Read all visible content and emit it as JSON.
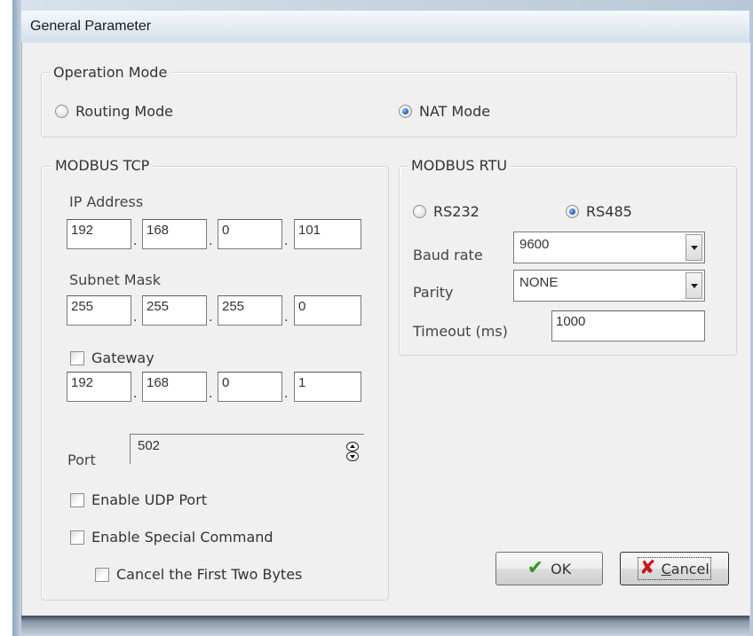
{
  "window": {
    "title": "General Parameter"
  },
  "operation_mode": {
    "title": "Operation Mode",
    "options": [
      {
        "label": "Routing Mode",
        "selected": false
      },
      {
        "label": "NAT Mode",
        "selected": true
      }
    ]
  },
  "modbus_tcp": {
    "title": "MODBUS TCP",
    "ip_address": {
      "label": "IP Address",
      "octets": [
        "192",
        "168",
        "0",
        "101"
      ]
    },
    "subnet_mask": {
      "label": "Subnet Mask",
      "octets": [
        "255",
        "255",
        "255",
        "0"
      ]
    },
    "gateway": {
      "label": "Gateway",
      "checked": false,
      "octets": [
        "192",
        "168",
        "0",
        "1"
      ]
    },
    "port": {
      "label": "Port",
      "value": "502"
    },
    "enable_udp": {
      "label": "Enable UDP Port",
      "checked": false
    },
    "enable_special": {
      "label": "Enable Special Command",
      "checked": false
    },
    "cancel_first_two": {
      "label": "Cancel the First Two Bytes",
      "checked": false
    }
  },
  "modbus_rtu": {
    "title": "MODBUS RTU",
    "interfaces": [
      {
        "label": "RS232",
        "selected": false
      },
      {
        "label": "RS485",
        "selected": true
      }
    ],
    "baud_rate": {
      "label": "Baud rate",
      "value": "9600"
    },
    "parity": {
      "label": "Parity",
      "value": "NONE"
    },
    "timeout": {
      "label": "Timeout (ms)",
      "value": "1000"
    }
  },
  "buttons": {
    "ok": "OK",
    "cancel_prefix": "",
    "cancel_underline": "C",
    "cancel_rest": "ancel"
  },
  "colors": {
    "ok_icon": "#2e9a1d",
    "cancel_icon": "#c8161d",
    "radio_selected": "#2a6fd0"
  },
  "icons": {
    "ok": "check-icon",
    "cancel": "x-icon"
  }
}
